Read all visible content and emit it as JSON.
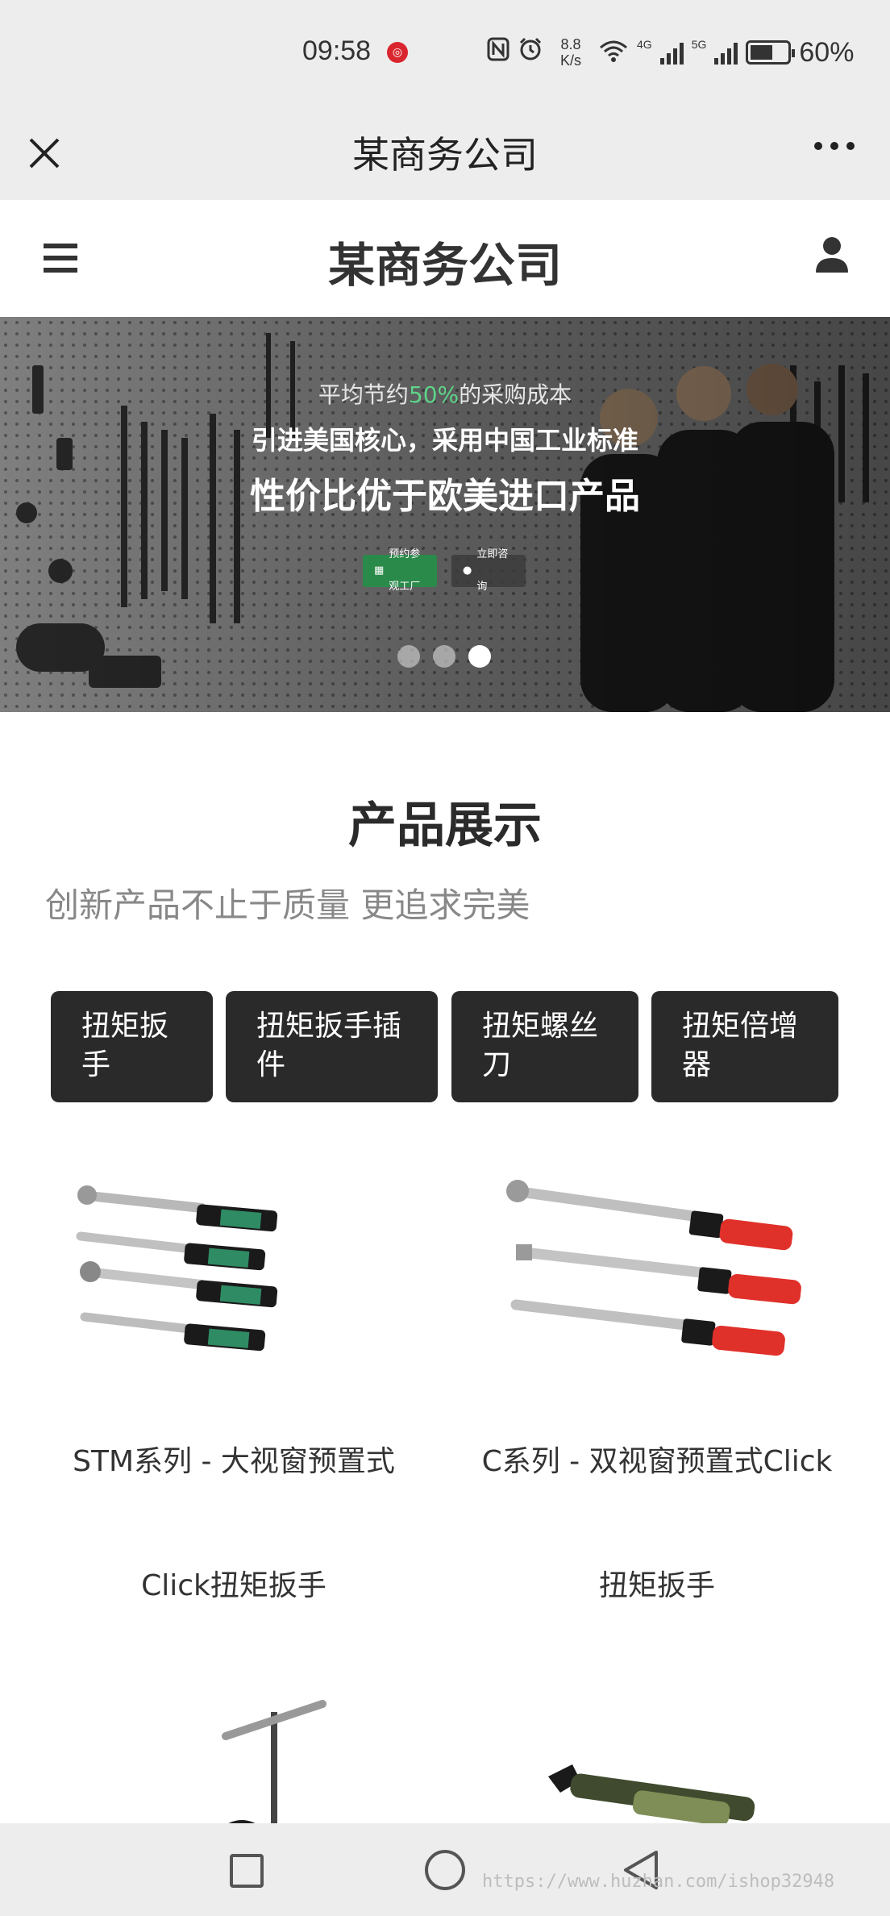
{
  "status_bar": {
    "time": "09:58",
    "network_speed_value": "8.8",
    "network_speed_unit": "K/s",
    "net_type_1": "4G",
    "net_type_2": "5G",
    "battery_percent": "60%",
    "battery_level": 0.6,
    "icons": [
      "nfc-icon",
      "alarm-icon",
      "wifi-icon",
      "signal-icon",
      "battery-icon"
    ]
  },
  "app_nav": {
    "title": "某商务公司"
  },
  "site_header": {
    "title": "某商务公司"
  },
  "banner": {
    "line1_prefix": "平均节约",
    "line1_highlight": "50%",
    "line1_suffix": "的采购成本",
    "line2": "引进美国核心，采用中国工业标准",
    "line3": "性价比优于欧美进口产品",
    "button_primary": "预约参观工厂",
    "button_secondary": "立即咨询",
    "slide_count": 3,
    "active_slide": 3,
    "highlight_color": "#5ed48a"
  },
  "products_section": {
    "title": "产品展示",
    "subtitle": "创新产品不止于质量 更追求完美",
    "categories": [
      {
        "label": "扭矩扳手"
      },
      {
        "label": "扭矩扳手插件"
      },
      {
        "label": "扭矩螺丝刀"
      },
      {
        "label": "扭矩倍增器"
      }
    ],
    "products": [
      {
        "name": "STM系列 - 大视窗预置式Click扭矩扳手",
        "line1": "STM系列 - 大视窗预置式",
        "line2": "Click扭矩扳手",
        "grip_color": "#2e8b63"
      },
      {
        "name": "C系列 - 双视窗预置式Click扭矩扳手",
        "line1": "C系列 - 双视窗预置式Click",
        "line2": "扭矩扳手",
        "grip_color": "#e0302a"
      }
    ]
  },
  "system_nav": {
    "watermark": "https://www.huzhan.com/ishop32948"
  }
}
